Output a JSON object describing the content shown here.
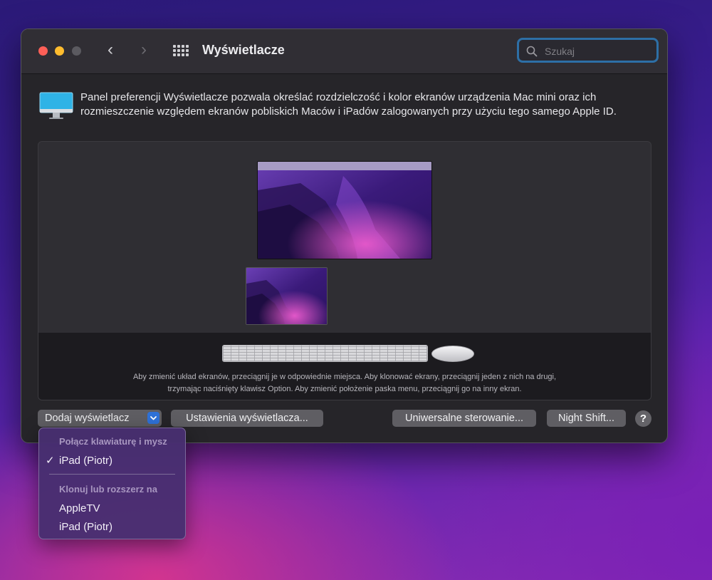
{
  "window": {
    "title": "Wyświetlacze",
    "search": {
      "placeholder": "Szukaj",
      "value": ""
    }
  },
  "description": "Panel preferencji Wyświetlacze pozwala określać rozdzielczość i kolor ekranów urządzenia Mac mini oraz ich rozmieszczenie względem ekranów pobliskich Maców i iPadów zalogowanych przy użyciu tego samego Apple ID.",
  "arrangement": {
    "hint_line1": "Aby zmienić układ ekranów, przeciągnij je w odpowiednie miejsca. Aby klonować ekrany, przeciągnij jeden z nich na drugi,",
    "hint_line2": "trzymając naciśnięty klawisz Option. Aby zmienić położenie paska menu, przeciągnij go na inny ekran."
  },
  "buttons": {
    "add_display": "Dodaj wyświetlacz",
    "display_settings": "Ustawienia wyświetlacza...",
    "universal_control": "Uniwersalne sterowanie...",
    "night_shift": "Night Shift...",
    "help": "?"
  },
  "dropdown": {
    "section1_title": "Połącz klawiaturę i mysz",
    "section1_item": "iPad (Piotr)",
    "section1_item_checked": true,
    "checkmark": "✓",
    "section2_title": "Klonuj lub rozszerz na",
    "section2_items": [
      "AppleTV",
      "iPad (Piotr)"
    ]
  },
  "colors": {
    "accent": "#2f72d9",
    "search_focus": "#2d6fa6",
    "window_bg": "#262529"
  },
  "icons": {
    "back": "‹",
    "forward": "›"
  }
}
